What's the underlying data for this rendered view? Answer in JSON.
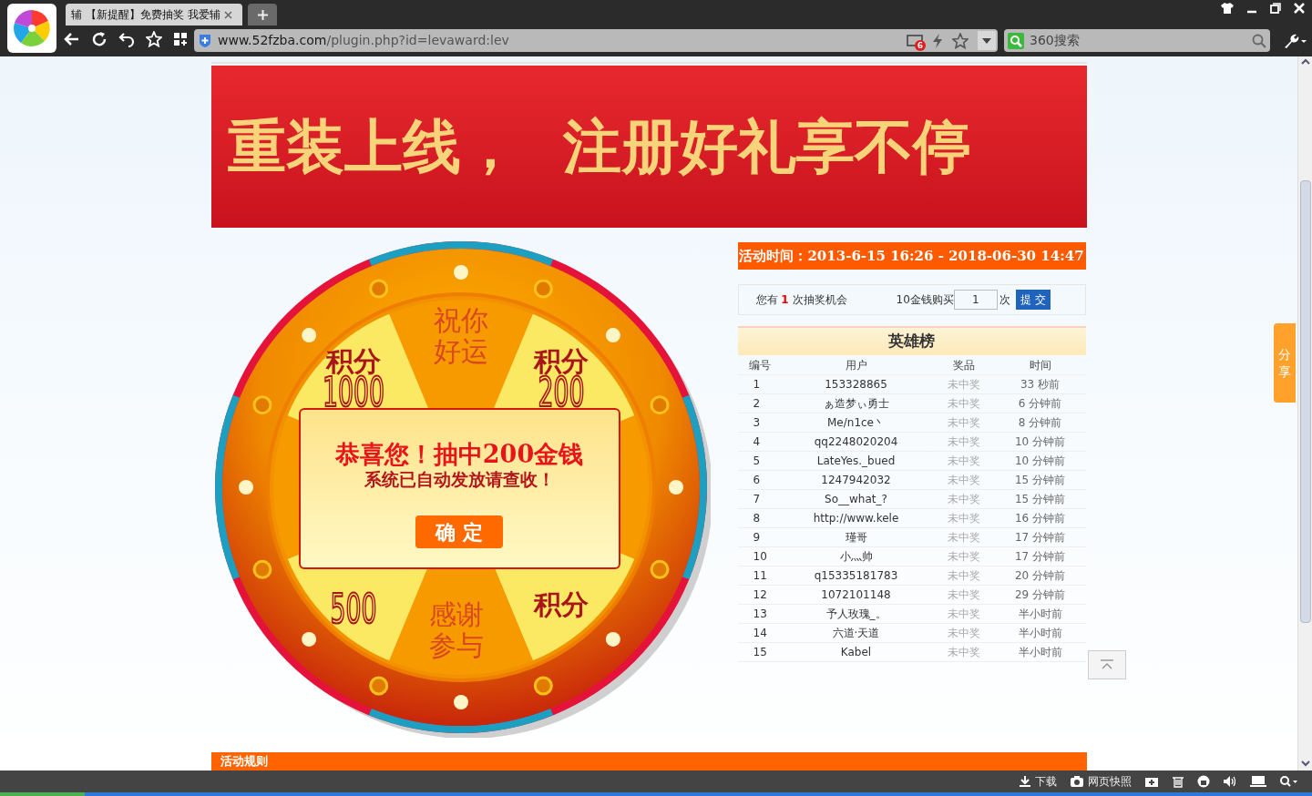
{
  "browser": {
    "tab_title": "辅 【新提醒】免费抽奖 我爱辅",
    "url_domain": "www.52fzba.com",
    "url_path": "/plugin.php?id=levaward:lev",
    "notification_count": "6",
    "search_placeholder": "360搜索"
  },
  "banner": {
    "headline_1": "重装上线，",
    "headline_2": "注册好礼享不停"
  },
  "wheel": {
    "labels": [
      {
        "kind": "plain",
        "lines": [
          "祝你",
          "好运"
        ]
      },
      {
        "kind": "points",
        "word": "积分",
        "number": "1000"
      },
      {
        "kind": "points",
        "word": "积分",
        "number": "200"
      },
      {
        "kind": "points_inverted",
        "number": "500"
      },
      {
        "kind": "plain",
        "lines": [
          "感谢",
          "参与"
        ]
      },
      {
        "kind": "points_inverted",
        "word": "积分"
      }
    ]
  },
  "dialog": {
    "title": "恭喜您！抽中200金钱",
    "message": "系统已自动发放请查收！",
    "button": "确 定"
  },
  "activity_time": {
    "label": "活动时间：",
    "range": "2013-6-15 16:26 - 2018-06-30 14:47"
  },
  "chances": {
    "prefix": "您有",
    "count": "1",
    "suffix": "次抽奖机会",
    "buy_label": "10金钱购买",
    "quantity": "1",
    "unit": "次",
    "submit": "提 交"
  },
  "leaderboard": {
    "title": "英雄榜",
    "columns": [
      "编号",
      "用户",
      "奖品",
      "时间"
    ],
    "rows": [
      [
        "1",
        "153328865",
        "未中奖",
        "33 秒前"
      ],
      [
        "2",
        "ぁ造梦ぃ勇士",
        "未中奖",
        "6 分钟前"
      ],
      [
        "3",
        "Me/n1ce丶",
        "未中奖",
        "8 分钟前"
      ],
      [
        "4",
        "qq2248020204",
        "未中奖",
        "10 分钟前"
      ],
      [
        "5",
        "LateYes._bued",
        "未中奖",
        "10 分钟前"
      ],
      [
        "6",
        "1247942032",
        "未中奖",
        "15 分钟前"
      ],
      [
        "7",
        "So__what_?",
        "未中奖",
        "15 分钟前"
      ],
      [
        "8",
        "http://www.kele",
        "未中奖",
        "16 分钟前"
      ],
      [
        "9",
        "瑾哥",
        "未中奖",
        "17 分钟前"
      ],
      [
        "10",
        "小灬帅",
        "未中奖",
        "17 分钟前"
      ],
      [
        "11",
        "q15335181783",
        "未中奖",
        "20 分钟前"
      ],
      [
        "12",
        "1072101148",
        "未中奖",
        "29 分钟前"
      ],
      [
        "13",
        "予人玫瑰_。",
        "未中奖",
        "半小时前"
      ],
      [
        "14",
        "六道·天道",
        "未中奖",
        "半小时前"
      ],
      [
        "15",
        "Kabel",
        "未中奖",
        "半小时前"
      ]
    ]
  },
  "rules": {
    "title": "活动规则"
  },
  "share": {
    "label": "分享"
  },
  "status_bar": {
    "download": "下载",
    "snapshot": "网页快照"
  }
}
